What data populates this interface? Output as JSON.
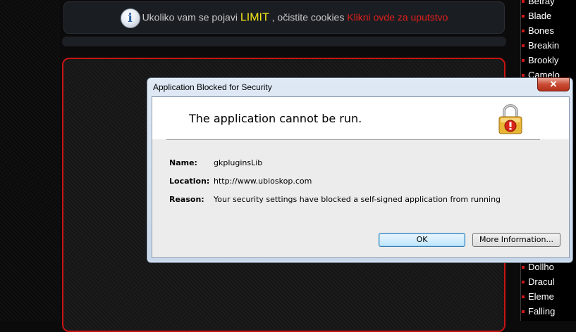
{
  "notice": {
    "text_before": "Ukoliko vam se pojavi ",
    "limit": "LIMIT",
    "text_after": " , očistite cookies ",
    "link": "Klikni ovde za uputstvo"
  },
  "sidebar": {
    "items": [
      "Betray",
      "Blade",
      "Bones",
      "Breakin",
      "Brookly",
      "Camelo",
      "Dollho",
      "Dracul",
      "Eleme",
      "Falling"
    ]
  },
  "dialog": {
    "title": "Application Blocked for Security",
    "close": "✕",
    "heading": "The application cannot be run.",
    "fields": [
      {
        "label": "Name:",
        "value": "gkpluginsLib"
      },
      {
        "label": "Location:",
        "value": "http://www.ubioskop.com"
      },
      {
        "label": "Reason:",
        "value": "Your security settings have blocked a self-signed application from running"
      }
    ],
    "ok_label": "OK",
    "more_label": "More Information..."
  },
  "colors": {
    "accent_red": "#c81414",
    "limit_yellow": "#f2e51a",
    "link_red": "#e0201e"
  }
}
